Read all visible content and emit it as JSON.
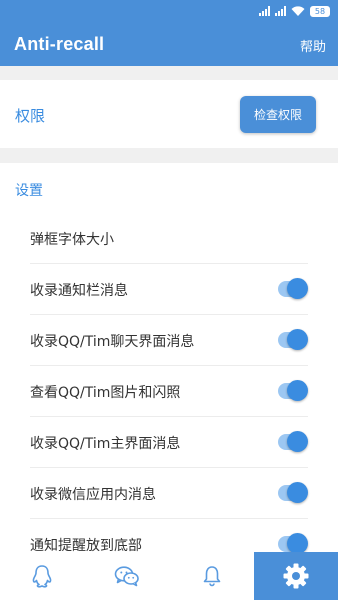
{
  "status_bar": {
    "battery": "58"
  },
  "app_bar": {
    "title": "Anti-recall",
    "help_label": "帮助"
  },
  "permissions": {
    "label": "权限",
    "check_button_label": "检查权限"
  },
  "settings": {
    "section_label": "设置",
    "items": [
      {
        "label": "弹框字体大小",
        "has_toggle": false
      },
      {
        "label": "收录通知栏消息",
        "has_toggle": true,
        "enabled": true
      },
      {
        "label": "收录QQ/Tim聊天界面消息",
        "has_toggle": true,
        "enabled": true
      },
      {
        "label": "查看QQ/Tim图片和闪照",
        "has_toggle": true,
        "enabled": true
      },
      {
        "label": "收录QQ/Tim主界面消息",
        "has_toggle": true,
        "enabled": true
      },
      {
        "label": "收录微信应用内消息",
        "has_toggle": true,
        "enabled": true
      },
      {
        "label": "通知提醒放到底部",
        "has_toggle": true,
        "enabled": true
      }
    ]
  },
  "bottom_nav": {
    "tabs": [
      {
        "icon": "qq-penguin-icon",
        "active": false
      },
      {
        "icon": "wechat-icon",
        "active": false
      },
      {
        "icon": "bell-icon",
        "active": false
      },
      {
        "icon": "gear-icon",
        "active": true
      }
    ]
  },
  "colors": {
    "primary": "#4a8fd8",
    "accent": "#3a8ce0",
    "divider": "#f0f0f0"
  }
}
